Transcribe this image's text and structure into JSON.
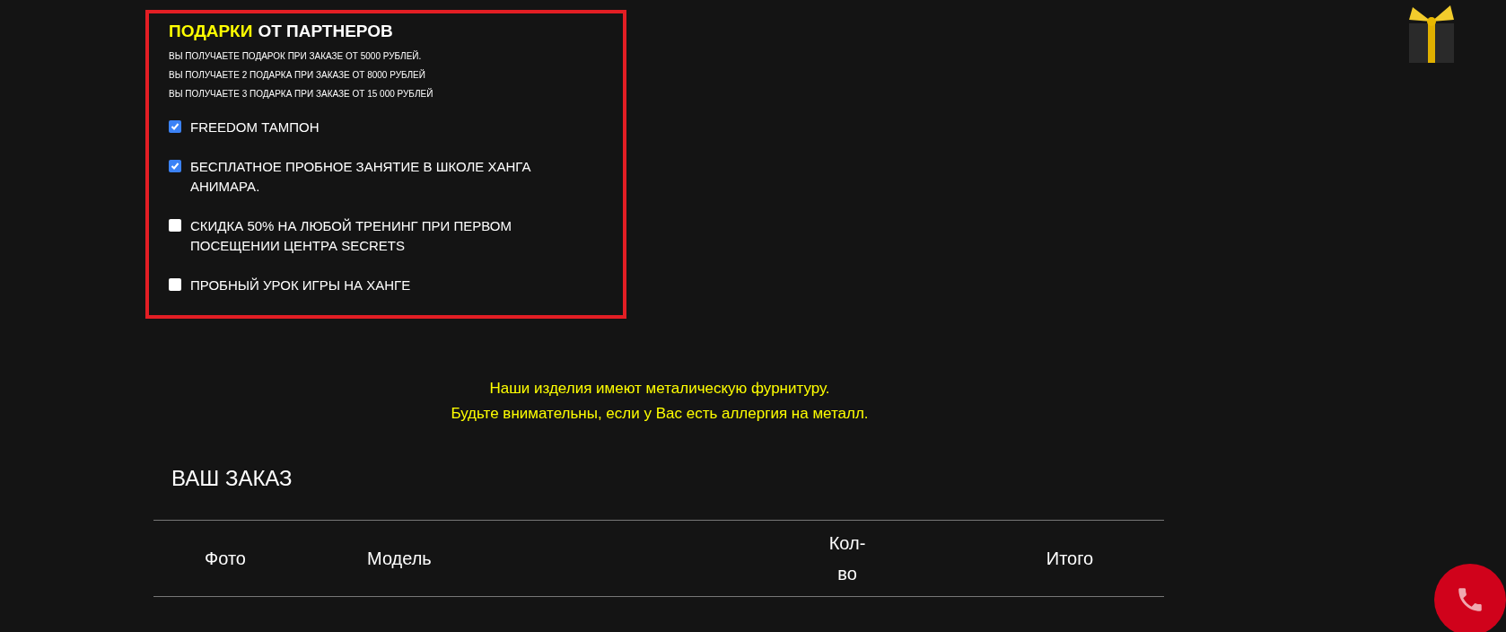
{
  "gifts": {
    "title_highlight": "ПОДАРКИ",
    "title_rest": "ОТ ПАРТНЕРОВ",
    "conditions": [
      "ВЫ ПОЛУЧАЕТЕ ПОДАРОК ПРИ ЗАКАЗЕ ОТ 5000 РУБЛЕЙ.",
      "ВЫ ПОЛУЧАЕТЕ 2 ПОДАРКА ПРИ ЗАКАЗЕ ОТ 8000 РУБЛЕЙ",
      "ВЫ ПОЛУЧАЕТЕ 3 ПОДАРКА ПРИ ЗАКАЗЕ ОТ 15 000 РУБЛЕЙ"
    ],
    "options": [
      {
        "label": "FREEDOM ТАМПОН",
        "checked": true
      },
      {
        "label": "БЕСПЛАТНОЕ ПРОБНОЕ ЗАНЯТИЕ В ШКОЛЕ ХАНГА АНИМАРА.",
        "checked": true
      },
      {
        "label": "СКИДКА 50% НА ЛЮБОЙ ТРЕНИНГ ПРИ ПЕРВОМ ПОСЕЩЕНИИ ЦЕНТРА SECRETS",
        "checked": false
      },
      {
        "label": "ПРОБНЫЙ УРОК ИГРЫ НА ХАНГЕ",
        "checked": false
      }
    ]
  },
  "notice": [
    "Наши изделия имеют металическую фурнитуру.",
    "Будьте внимательны, если у Вас есть аллергия на металл."
  ],
  "order": {
    "title": "ВАШ ЗАКАЗ",
    "columns": [
      "Фото",
      "Модель",
      "Кол-\nво",
      "Итого"
    ]
  }
}
